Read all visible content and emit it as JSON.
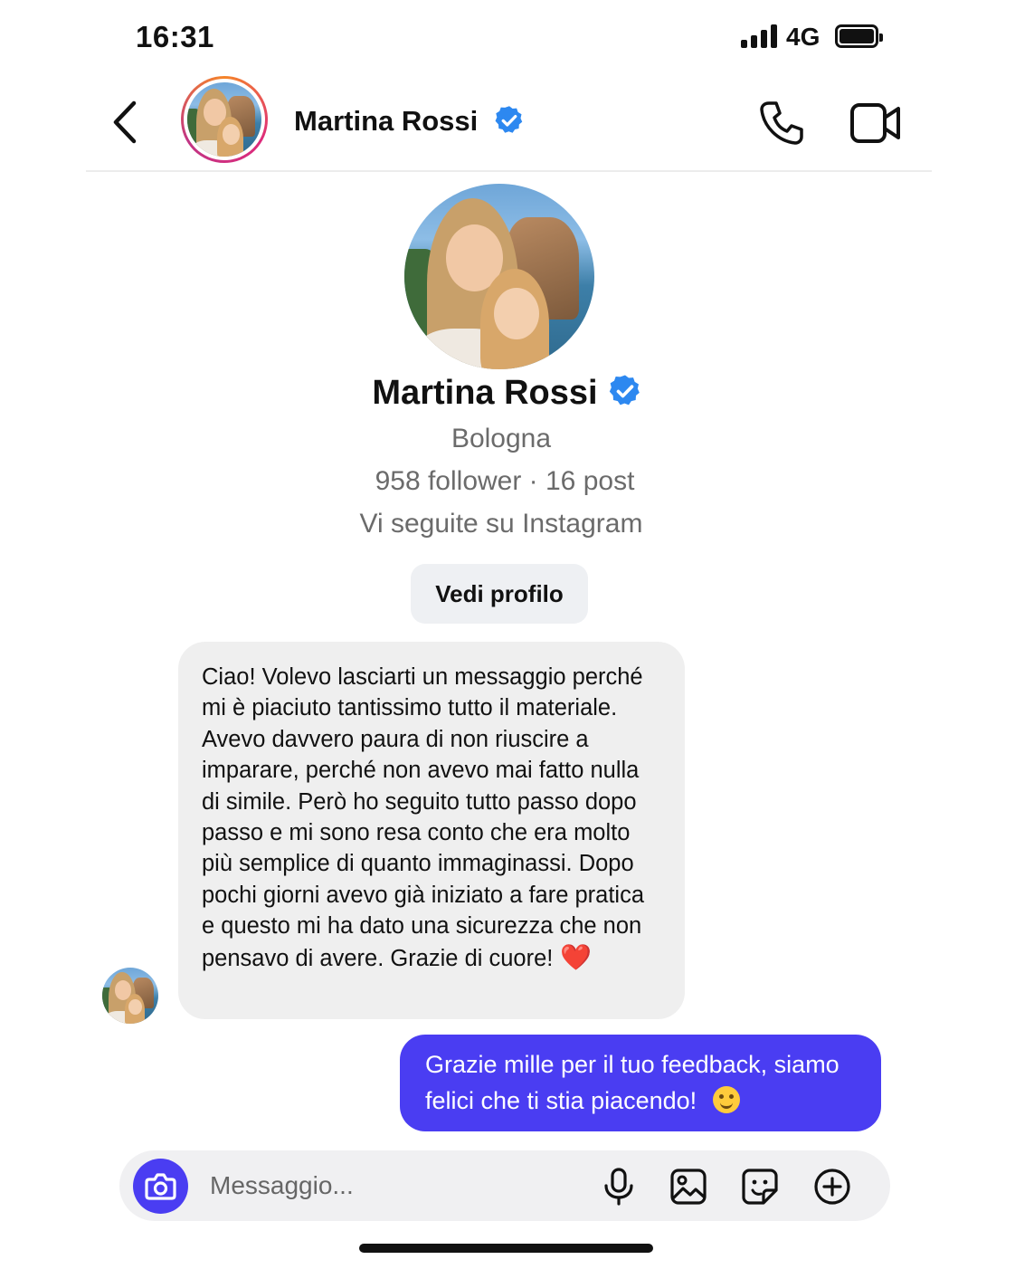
{
  "status_bar": {
    "time": "16:31",
    "network": "4G",
    "icons": [
      "signal-icon",
      "battery-icon"
    ]
  },
  "header": {
    "name": "Martina Rossi",
    "verified": true,
    "icons": [
      "back-icon",
      "phone-icon",
      "video-call-icon",
      "verified-badge-icon"
    ]
  },
  "profile": {
    "name": "Martina Rossi",
    "city": "Bologna",
    "stats": "958 follower · 16 post",
    "mutual": "Vi seguite su Instagram",
    "view_profile_label": "Vedi profilo"
  },
  "messages": [
    {
      "direction": "incoming",
      "text": "Ciao! Volevo lasciarti un messaggio perché mi è piaciuto tantissimo tutto il materiale. Avevo davvero paura di non riuscire a imparare, perché non avevo mai fatto nulla di simile. Però ho seguito tutto passo dopo passo e mi sono resa conto che era molto più semplice di quanto immaginassi. Dopo pochi giorni avevo già iniziato a fare pratica e questo mi ha dato una sicurezza che non pensavo di avere. Grazie di cuore!",
      "emoji": "❤️"
    },
    {
      "direction": "outgoing",
      "text": "Grazie mille per il tuo feedback, siamo felici che ti stia piacendo!",
      "emoji": "😊"
    }
  ],
  "composer": {
    "placeholder": "Messaggio...",
    "icons": [
      "camera-icon",
      "microphone-icon",
      "gallery-icon",
      "sticker-icon",
      "add-icon"
    ]
  },
  "colors": {
    "accent": "#4a3df2",
    "verified": "#2d88f0",
    "incoming_bubble": "#efefef",
    "secondary_text": "#6b6b6b"
  }
}
